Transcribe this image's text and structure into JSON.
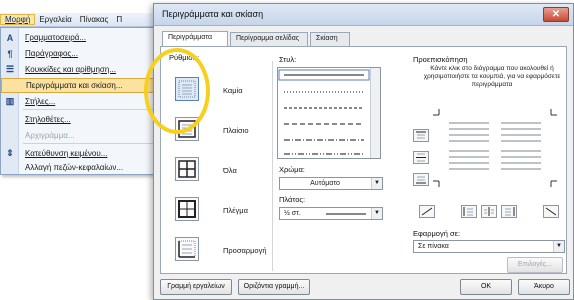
{
  "menubar": {
    "items": [
      "Μορφή",
      "Εργαλεία",
      "Πίνακας",
      "Π"
    ]
  },
  "menu": {
    "items": [
      {
        "label": "Γραμματοσειρά...",
        "icon": "font-icon",
        "glyph": "A"
      },
      {
        "label": "Παράγραφος...",
        "icon": "paragraph-icon",
        "glyph": "¶"
      },
      {
        "label": "Κουκκίδες και αρίθμηση...",
        "icon": "bullets-icon",
        "glyph": "☰"
      },
      {
        "label": "Περιγράμματα και σκίαση...",
        "icon": "",
        "glyph": ""
      },
      {
        "label": "Στήλες...",
        "icon": "columns-icon",
        "glyph": "▥"
      },
      {
        "label": "Στηλοθέτες...",
        "icon": "",
        "glyph": ""
      },
      {
        "label": "Αρχιγράμμα...",
        "icon": "",
        "glyph": ""
      },
      {
        "label": "Κατεύθυνση κειμένου...",
        "icon": "text-direction-icon",
        "glyph": "⇕"
      },
      {
        "label": "Αλλαγή πεζών-κεφαλαίων...",
        "icon": "",
        "glyph": ""
      }
    ]
  },
  "dialog": {
    "title": "Περιγράμματα και σκίαση",
    "close_glyph": "✕",
    "tabs": [
      "Περιγράμματα",
      "Περίγραμμα σελίδας",
      "Σκίαση"
    ],
    "setting": {
      "label": "Ρύθμιση:",
      "options": [
        "Καμία",
        "Πλαίσιο",
        "Όλα",
        "Πλέγμα",
        "Προσαρμογή"
      ]
    },
    "style": {
      "label": "Στυλ:"
    },
    "color": {
      "label": "Χρώμα:",
      "value": "Αυτόματο"
    },
    "width": {
      "label": "Πλάτος:",
      "value": "½ στ."
    },
    "preview": {
      "label": "Προεπισκόπηση",
      "hint": "Κάντε κλικ στο διάγραμμα που ακολουθεί ή χρησιμοποιήστε τα κουμπιά, για να εφαρμόσετε περιγράμματα"
    },
    "apply_to": {
      "label": "Εφαρμογή σε:",
      "value": "Σε πίνακα"
    },
    "options_button": "Επιλογές...",
    "toolbar_button": "Γραμμή εργαλείων",
    "horizontal_line_button": "Οριζόντια γραμμή...",
    "ok_button": "ΟΚ",
    "cancel_button": "Άκυρο"
  }
}
